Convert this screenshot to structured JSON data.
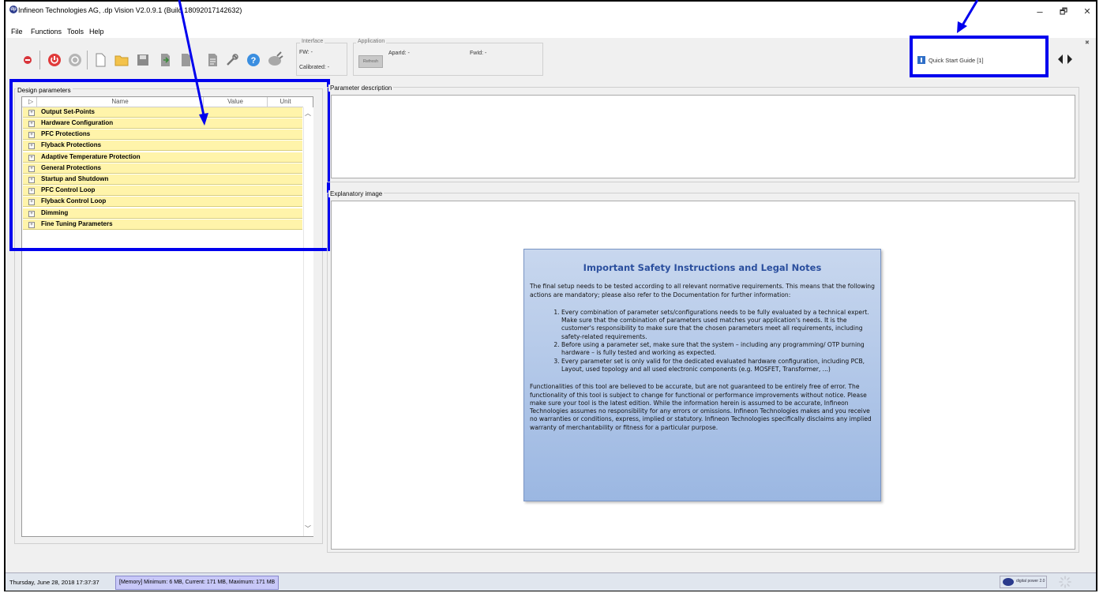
{
  "window": {
    "title": "Infineon Technologies AG, .dp Vision V2.0.9.1 (Build 18092017142632)",
    "logo_text": "dp",
    "minimize_glyph": "–",
    "restore_glyph": "🗗",
    "close_glyph": "✕"
  },
  "menu": [
    "File",
    "Functions",
    "Tools",
    "Help"
  ],
  "toolbar": {
    "icons": [
      "record-icon",
      "power-icon",
      "disconnect-icon",
      "new-file-icon",
      "open-folder-icon",
      "save-icon",
      "export-icon",
      "import-icon",
      "report-icon",
      "tools-icon",
      "help-icon",
      "connect-plug-icon"
    ]
  },
  "interface": {
    "label": "Interface",
    "fw": "FW: -",
    "calibrated": "Calibrated: -"
  },
  "application": {
    "label": "Application",
    "refresh": "Refresh",
    "aparid": "AparId: -",
    "fwid": "FwId: -"
  },
  "quick_start": {
    "label": "Quick Start Guide [1]",
    "close_glyph": "✖"
  },
  "design_parameters": {
    "label": "Design parameters",
    "columns": [
      "Name",
      "Value",
      "Unit"
    ],
    "rows": [
      "Output Set-Points",
      "Hardware Configuration",
      "PFC Protections",
      "Flyback Protections",
      "Adaptive Temperature Protection",
      "General Protections",
      "Startup and Shutdown",
      "PFC Control Loop",
      "Flyback Control Loop",
      "Dimming",
      "Fine Tuning Parameters"
    ]
  },
  "parameter_description": {
    "label": "Parameter description"
  },
  "explanatory_image": {
    "label": "Explanatory image"
  },
  "safety": {
    "title": "Important Safety Instructions and Legal Notes",
    "intro": "The final setup needs to be tested according to all relevant normative requirements. This means that the following actions are mandatory; please also refer to the Documentation for further information:",
    "items": [
      "Every combination of parameter sets/configurations needs to be fully evaluated by a technical expert. Make sure that the combination of parameters used matches your application's needs. It is the customer's responsibility to make sure that the chosen parameters meet all requirements, including safety-related requirements.",
      "Before using a parameter set, make sure that the system – including any programming/ OTP burning hardware – is fully tested and working as expected.",
      "Every parameter set is only valid for the dedicated evaluated hardware configuration, including PCB, Layout, used topology and all used electronic components (e.g. MOSFET, Transformer, ...)"
    ],
    "closing": "Functionalities of this tool are believed to be accurate, but are not guaranteed to be entirely free of error. The functionality of this tool is subject to change for functional or performance improvements without notice. Please make sure your tool is the latest edition. While the information herein is assumed to be accurate, Infineon Technologies assumes no responsibility for any errors or omissions. Infineon Technologies makes and you receive no warranties or conditions, express, implied or statutory. Infineon Technologies specifically disclaims any implied warranty of merchantability or fitness for a particular purpose."
  },
  "status": {
    "datetime": "Thursday, June 28, 2018  17:37:37",
    "memory": "[Memory] Minimum: 6 MB, Current: 171 MB, Maximum: 171 MB",
    "brand": "digital power 2.0"
  },
  "colors": {
    "highlight_box": "#0000ee",
    "tree_row_bg": "#fff4aa",
    "safety_title": "#2b4f9e"
  }
}
